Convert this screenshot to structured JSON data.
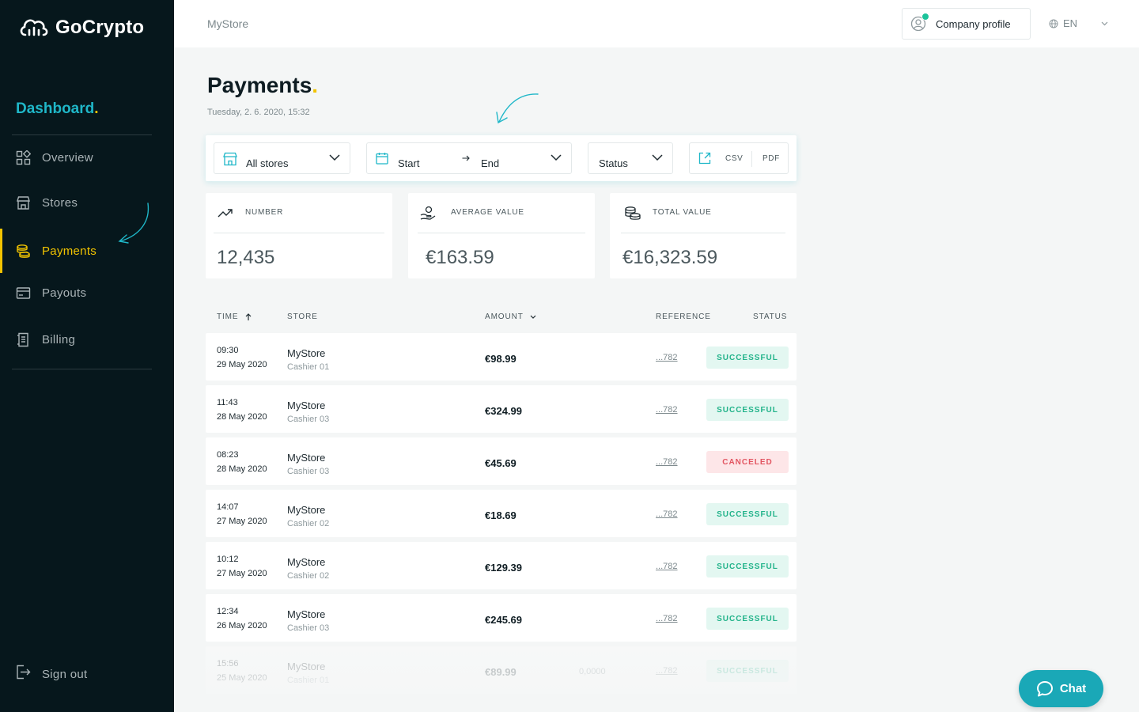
{
  "brand": {
    "name": "GoCrypto",
    "accent": "#1fb7c8",
    "highlight": "#f2c400",
    "sidebar_bg": "#06171c"
  },
  "sidebar": {
    "section_title": "Dashboard",
    "section_dot": ".",
    "items": [
      {
        "label": "Overview",
        "icon": "grid-icon"
      },
      {
        "label": "Stores",
        "icon": "store-icon"
      },
      {
        "label": "Payments",
        "icon": "coins-icon",
        "active": true
      },
      {
        "label": "Payouts",
        "icon": "card-icon"
      },
      {
        "label": "Billing",
        "icon": "receipt-icon"
      }
    ],
    "sign_out": "Sign out"
  },
  "topbar": {
    "store_name": "MyStore",
    "company_profile": "Company profile",
    "language": "EN"
  },
  "page": {
    "title": "Payments",
    "title_dot": ".",
    "date": "Tuesday, 2. 6. 2020, 15:32"
  },
  "filters": {
    "store": "All stores",
    "start": "Start",
    "end": "End",
    "status": "Status",
    "export_csv": "CSV",
    "export_pdf": "PDF"
  },
  "stats": [
    {
      "label": "NUMBER",
      "value": "12,435",
      "icon": "trend-up-icon"
    },
    {
      "label": "AVERAGE VALUE",
      "value": "€163.59",
      "icon": "coin-hand-icon"
    },
    {
      "label": "TOTAL VALUE",
      "value": "€16,323.59",
      "icon": "coin-stack-icon"
    }
  ],
  "table": {
    "headers": {
      "time": "TIME",
      "store": "STORE",
      "amount": "AMOUNT",
      "reference": "REFERENCE",
      "status": "STATUS"
    },
    "rows": [
      {
        "time": "09:30",
        "date": "29 May 2020",
        "store": "MyStore",
        "cashier": "Cashier 01",
        "amount": "€98.99",
        "extra": "",
        "ref": "...782",
        "status": "SUCCESSFUL"
      },
      {
        "time": "11:43",
        "date": "28 May 2020",
        "store": "MyStore",
        "cashier": "Cashier 03",
        "amount": "€324.99",
        "extra": "",
        "ref": "...782",
        "status": "SUCCESSFUL"
      },
      {
        "time": "08:23",
        "date": "28 May 2020",
        "store": "MyStore",
        "cashier": "Cashier 03",
        "amount": "€45.69",
        "extra": "",
        "ref": "...782",
        "status": "CANCELED"
      },
      {
        "time": "14:07",
        "date": "27 May 2020",
        "store": "MyStore",
        "cashier": "Cashier 02",
        "amount": "€18.69",
        "extra": "",
        "ref": "...782",
        "status": "SUCCESSFUL"
      },
      {
        "time": "10:12",
        "date": "27 May 2020",
        "store": "MyStore",
        "cashier": "Cashier 02",
        "amount": "€129.39",
        "extra": "",
        "ref": "...782",
        "status": "SUCCESSFUL"
      },
      {
        "time": "12:34",
        "date": "26 May 2020",
        "store": "MyStore",
        "cashier": "Cashier 03",
        "amount": "€245.69",
        "extra": "",
        "ref": "...782",
        "status": "SUCCESSFUL"
      },
      {
        "time": "15:56",
        "date": "25 May 2020",
        "store": "MyStore",
        "cashier": "Cashier 01",
        "amount": "€89.99",
        "extra": "0,0000",
        "ref": "...782",
        "status": "SUCCESSFUL"
      }
    ]
  },
  "chat": {
    "label": "Chat"
  }
}
